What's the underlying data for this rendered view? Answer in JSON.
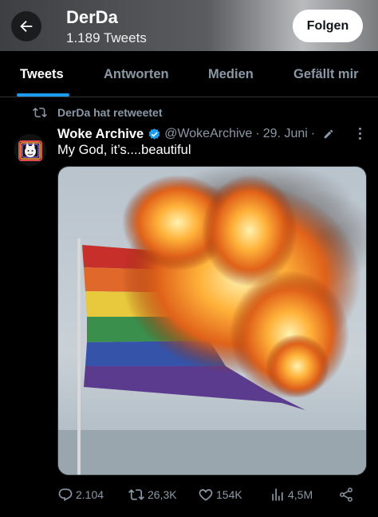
{
  "header": {
    "name": "DerDa",
    "tweet_count": "1.189 Tweets",
    "follow_label": "Folgen"
  },
  "tabs": [
    {
      "label": "Tweets",
      "active": true
    },
    {
      "label": "Antworten",
      "active": false
    },
    {
      "label": "Medien",
      "active": false
    },
    {
      "label": "Gefällt mir",
      "active": false
    }
  ],
  "retweet": {
    "text": "DerDa hat retweetet",
    "icon": "retweet-icon"
  },
  "tweet": {
    "author": "Woke Archive",
    "verified": true,
    "handle": "@WokeArchive",
    "separator": "·",
    "date": "29. Juni",
    "separator2": "·",
    "text": "My God, it’s....beautiful",
    "media_description": "photo",
    "actions": {
      "replies": "2.104",
      "retweets": "26,3K",
      "likes": "154K",
      "views": "4,5M"
    }
  },
  "colors": {
    "accent": "#1d9bf0",
    "background": "#000000",
    "muted_text": "#8b98a5",
    "text": "#ffffff"
  }
}
